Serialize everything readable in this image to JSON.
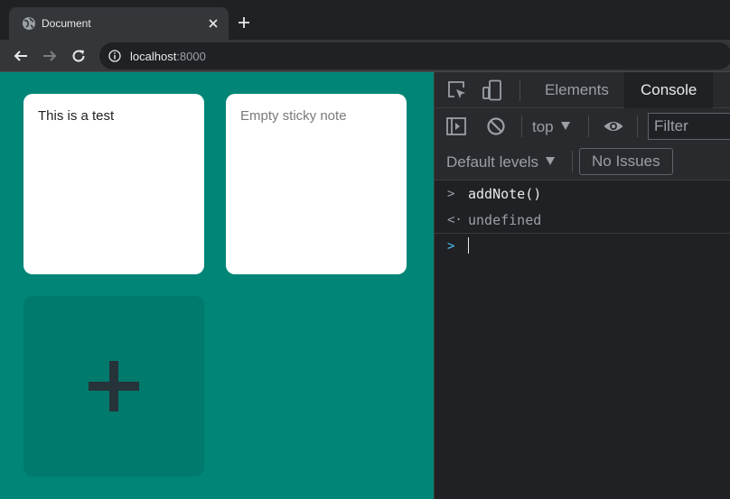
{
  "browser": {
    "tab_title": "Document",
    "url_host": "localhost",
    "url_port": ":8000"
  },
  "page": {
    "notes": [
      {
        "text": "This is a test"
      },
      {
        "text": "Empty sticky note"
      }
    ],
    "add_button_symbol": "+"
  },
  "devtools": {
    "tabs": [
      "Elements",
      "Console"
    ],
    "active_tab": "Console",
    "context": "top",
    "filter_placeholder": "Filter",
    "levels": "Default levels",
    "issues": "No Issues",
    "console_lines": [
      {
        "type": "input",
        "text": "addNote()"
      },
      {
        "type": "result",
        "text": "undefined"
      }
    ]
  },
  "colors": {
    "page_background": "#008577",
    "note_background": "#ffffff",
    "add_button_background": "#007a6c",
    "devtools_background": "#202124"
  }
}
